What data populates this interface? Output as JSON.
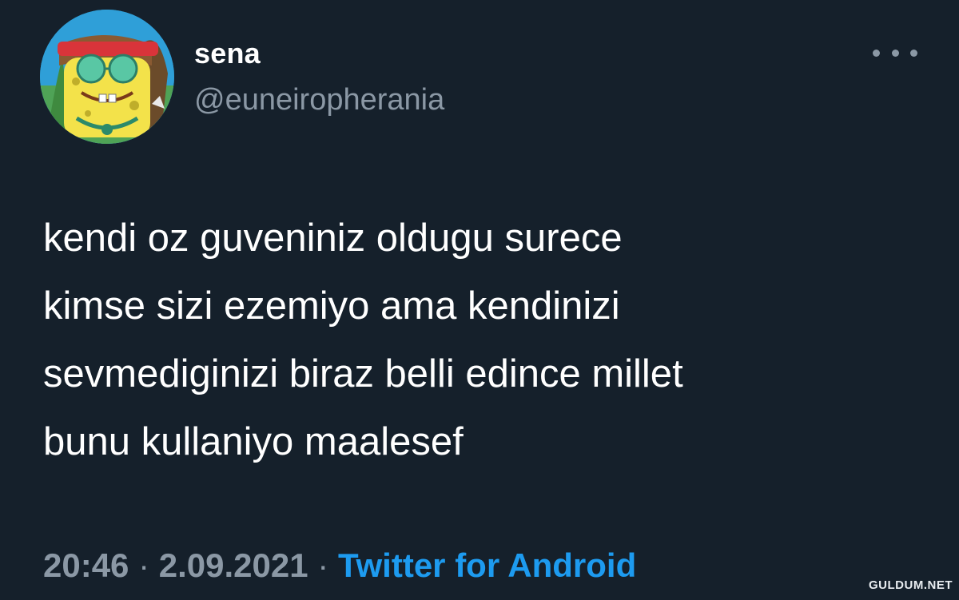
{
  "user": {
    "display_name": "sena",
    "handle": "@euneiropherania"
  },
  "tweet": {
    "lines": [
      "kendi oz guveniniz oldugu surece",
      "kimse sizi ezemiyo ama kendinizi",
      "sevmediginizi biraz belli edince millet",
      "bunu kullaniyo maalesef"
    ]
  },
  "meta": {
    "time": "20:46",
    "separator": "·",
    "date": "2.09.2021",
    "source": "Twitter for Android"
  },
  "watermark": "GULDUM.NET",
  "colors": {
    "background": "#15202b",
    "text": "#ffffff",
    "muted": "#8b98a5",
    "accent": "#1d9bf0"
  },
  "icons": {
    "more": "more-horizontal-icon",
    "avatar": "cartoon-avatar-image"
  }
}
